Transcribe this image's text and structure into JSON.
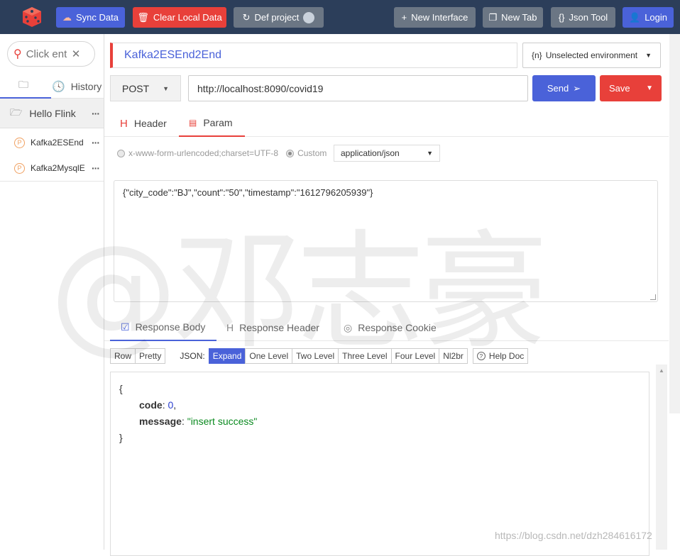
{
  "topbar": {
    "sync_label": "Sync Data",
    "clear_label": "Clear Local Data",
    "project_label": "Def project",
    "new_interface_label": "New Interface",
    "new_tab_label": "New Tab",
    "json_tool_label": "Json Tool",
    "login_label": "Login"
  },
  "sidebar": {
    "search_placeholder": "Click enter to search",
    "tab_history": "History",
    "folder_label": "Hello Flink",
    "items": [
      {
        "badge": "P",
        "label": "Kafka2ESEnd"
      },
      {
        "badge": "P",
        "label": "Kafka2MysqlE"
      }
    ]
  },
  "request": {
    "name": "Kafka2ESEnd2End",
    "environment": "Unselected environment",
    "env_icon": "{n}",
    "method": "POST",
    "url": "http://localhost:8090/covid19",
    "send_label": "Send",
    "save_label": "Save",
    "tabs": {
      "header": "Header",
      "param": "Param"
    },
    "content_type_form": "x-www-form-urlencoded;charset=UTF-8",
    "content_type_custom": "Custom",
    "content_type_value": "application/json",
    "body": "{\"city_code\":\"BJ\",\"count\":\"50\",\"timestamp\":\"1612796205939\"}"
  },
  "response": {
    "tabs": {
      "body": "Response Body",
      "header": "Response Header",
      "cookie": "Response Cookie"
    },
    "toolbar": {
      "row": "Row",
      "pretty": "Pretty",
      "json_label": "JSON:",
      "expand": "Expand",
      "one_level": "One Level",
      "two_level": "Two Level",
      "three_level": "Three Level",
      "four_level": "Four Level",
      "nl2br": "Nl2br",
      "help_doc": "Help Doc"
    },
    "json": {
      "open_brace": "{",
      "code_key": "code",
      "code_value": "0",
      "message_key": "message",
      "message_value": "\"insert success\"",
      "close_brace": "}"
    }
  },
  "watermark": {
    "text": "@邓志豪",
    "credit": "https://blog.csdn.net/dzh284616172"
  },
  "colors": {
    "accent": "#4a62d9",
    "danger": "#e8403a",
    "topbar": "#2c3e5a"
  }
}
